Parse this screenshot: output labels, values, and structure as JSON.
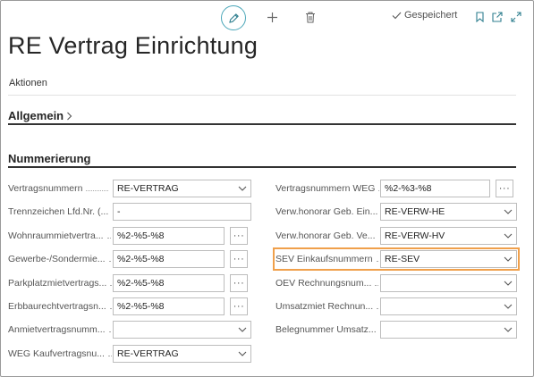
{
  "toolbar": {
    "edit_icon": "pencil-icon",
    "add_icon": "plus-icon",
    "delete_icon": "trash-icon",
    "saved_label": "Gespeichert",
    "bookmark_icon": "bookmark-icon",
    "open_new_icon": "open-new-window-icon",
    "expand_icon": "expand-icon",
    "accent_color": "#4aa6b8"
  },
  "page": {
    "title": "RE Vertrag Einrichtung",
    "actions_label": "Aktionen"
  },
  "sections": {
    "general": "Allgemein",
    "numbering": "Nummerierung"
  },
  "left_fields": [
    {
      "label": "Vertragsnummern",
      "value": "RE-VERTRAG",
      "type": "select"
    },
    {
      "label": "Trennzeichen Lfd.Nr. (...",
      "value": "-",
      "type": "text"
    },
    {
      "label": "Wohnraummietvertra...",
      "value": "%2-%5-%8",
      "type": "lookup"
    },
    {
      "label": "Gewerbe-/Sondermie...",
      "value": "%2-%5-%8",
      "type": "lookup"
    },
    {
      "label": "Parkplatzmietvertrags...",
      "value": "%2-%5-%8",
      "type": "lookup"
    },
    {
      "label": "Erbbaurechtvertragsn...",
      "value": "%2-%5-%8",
      "type": "lookup"
    },
    {
      "label": "Anmietvertragsnumm...",
      "value": "",
      "type": "select"
    },
    {
      "label": "WEG Kaufvertragsnu...",
      "value": "RE-VERTRAG",
      "type": "select"
    }
  ],
  "right_fields": [
    {
      "label": "Vertragsnummern WEG",
      "value": "%2-%3-%8",
      "type": "lookup"
    },
    {
      "label": "Verw.honorar Geb. Ein...",
      "value": "RE-VERW-HE",
      "type": "select"
    },
    {
      "label": "Verw.honorar Geb. Ve...",
      "value": "RE-VERW-HV",
      "type": "select"
    },
    {
      "label": "SEV Einkaufsnummern",
      "value": "RE-SEV",
      "type": "select",
      "highlighted": true
    },
    {
      "label": "OEV Rechnungsnum...",
      "value": "",
      "type": "select"
    },
    {
      "label": "Umsatzmiet Rechnun...",
      "value": "",
      "type": "select"
    },
    {
      "label": "Belegnummer Umsatz...",
      "value": "",
      "type": "select"
    }
  ],
  "highlight_color": "#f0a04b"
}
